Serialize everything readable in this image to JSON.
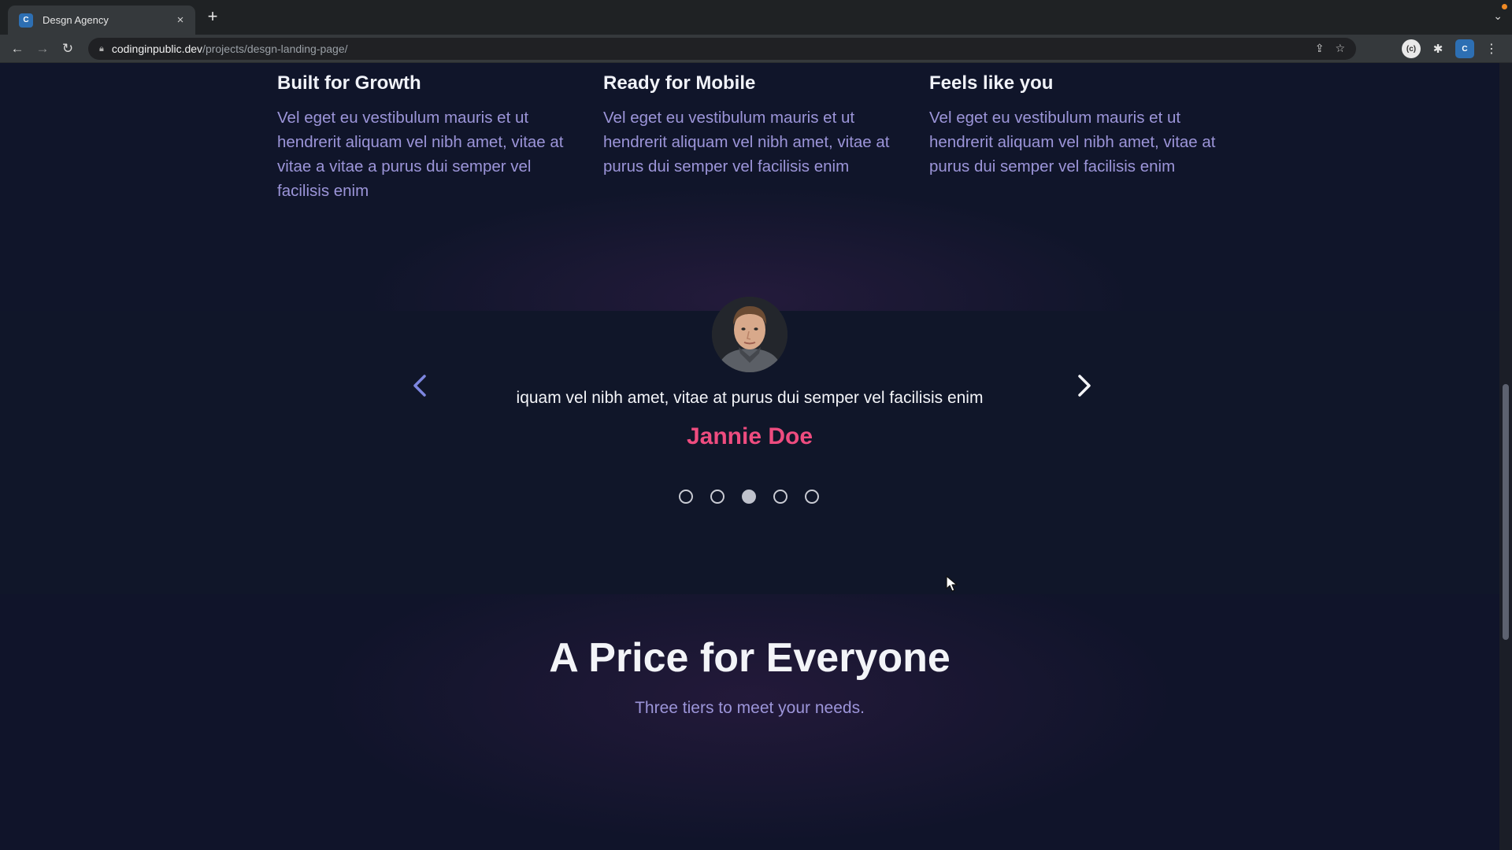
{
  "browser": {
    "tab_title": "Desgn Agency",
    "tab_close": "×",
    "new_tab": "+",
    "url_host": "codinginpublic.dev",
    "url_path": "/projects/desgn-landing-page/",
    "favicon_text": "C",
    "profile_text": "(c)",
    "app_text": "C"
  },
  "features": [
    {
      "title": "Built for Growth",
      "text": "Vel eget eu vestibulum mauris et ut hendrerit aliquam vel nibh amet, vitae at vitae a vitae a purus dui semper vel facilisis enim"
    },
    {
      "title": "Ready for Mobile",
      "text": "Vel eget eu vestibulum mauris et ut hendrerit aliquam vel nibh amet, vitae at purus dui semper vel facilisis enim"
    },
    {
      "title": "Feels like you",
      "text": "Vel eget eu vestibulum mauris et ut hendrerit aliquam vel nibh amet, vitae at purus dui semper vel facilisis enim"
    }
  ],
  "testimonial": {
    "quote": "iquam vel nibh amet, vitae at purus dui semper vel facilisis enim",
    "name": "Jannie Doe",
    "dot_count": 5,
    "active_dot": 3
  },
  "pricing": {
    "title": "A Price for Everyone",
    "subtitle": "Three tiers to meet your needs."
  },
  "colors": {
    "accent_name": "#ee4c7f",
    "body_text": "#9c95d9",
    "background": "#10152a"
  },
  "icons": [
    "back-arrow-icon",
    "forward-arrow-icon",
    "reload-icon",
    "lock-icon",
    "share-icon",
    "star-icon",
    "puzzle-icon",
    "kebab-menu-icon",
    "chevron-left-icon",
    "chevron-right-icon",
    "cursor-icon"
  ]
}
